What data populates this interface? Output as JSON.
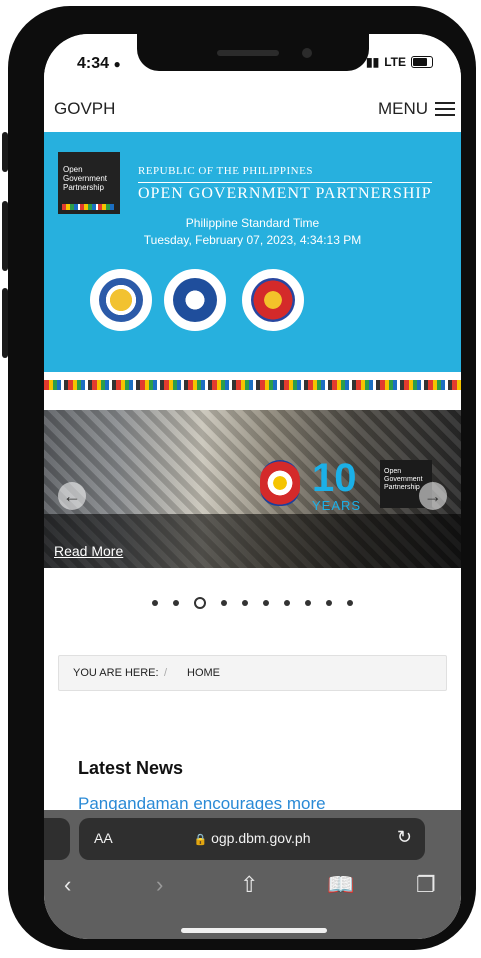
{
  "status_bar": {
    "time": "4:34",
    "network": "LTE"
  },
  "header": {
    "brand": "GOVPH",
    "menu_label": "MENU"
  },
  "hero": {
    "logo_text": "Open Government Partnership",
    "republic": "REPUBLIC OF THE PHILIPPINES",
    "title": "OPEN GOVERNMENT PARTNERSHIP",
    "pst_label": "Philippine Standard Time",
    "pst_time": "Tuesday, February 07, 2023, 4:34:13 PM"
  },
  "banner": {
    "big_number": "10",
    "years": "YEARS",
    "logo_text": "Open Government Partnership",
    "read_more": "Read More"
  },
  "carousel": {
    "dot_count": 10,
    "active_index": 2
  },
  "breadcrumb": {
    "label": "YOU ARE HERE:",
    "separator": "/",
    "home": "HOME"
  },
  "news": {
    "heading": "Latest News",
    "first_title": "Pangandaman encourages more"
  },
  "browser": {
    "aa_label": "AA",
    "url": "ogp.dbm.gov.ph"
  },
  "icons": [
    "user-icon",
    "signal-icon",
    "battery-icon",
    "hamburger-icon",
    "back-arrow-icon",
    "forward-arrow-icon",
    "share-icon",
    "bookmarks-icon",
    "tabs-icon",
    "lock-icon",
    "reload-icon"
  ]
}
